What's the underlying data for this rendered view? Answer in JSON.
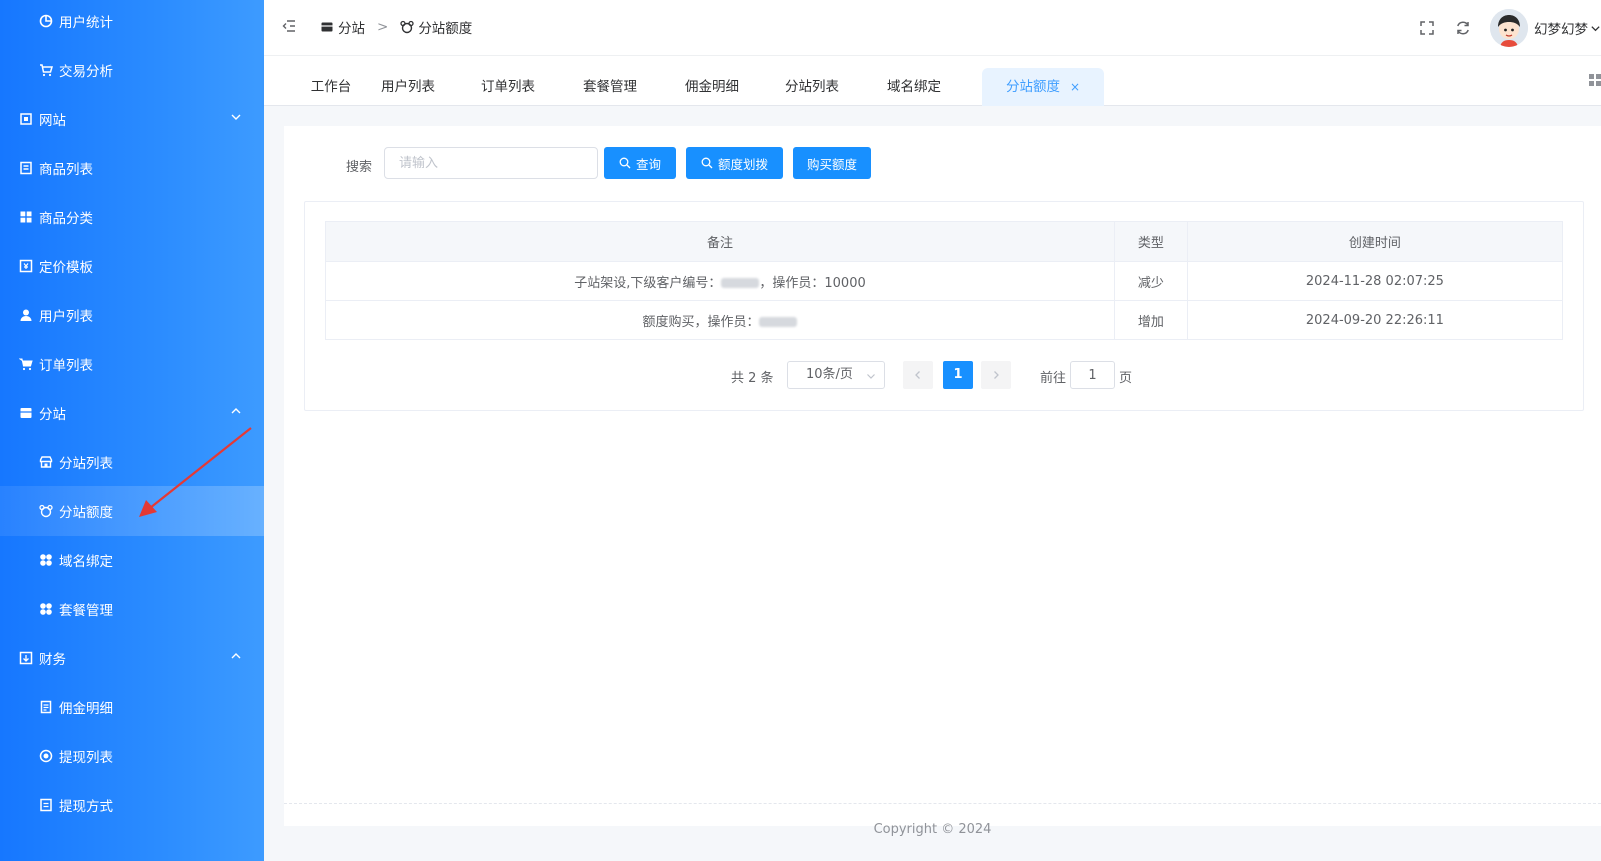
{
  "sidebar": {
    "items": [
      {
        "label": "用户统计",
        "icon": "pie-chart-icon",
        "level": 2
      },
      {
        "label": "交易分析",
        "icon": "cart-icon",
        "level": 2
      },
      {
        "label": "网站",
        "icon": "building-icon",
        "level": 1,
        "expanded": false
      },
      {
        "label": "商品列表",
        "icon": "list-icon",
        "level": 1
      },
      {
        "label": "商品分类",
        "icon": "grid-icon",
        "level": 1
      },
      {
        "label": "定价模板",
        "icon": "price-icon",
        "level": 1
      },
      {
        "label": "用户列表",
        "icon": "user-icon",
        "level": 1
      },
      {
        "label": "订单列表",
        "icon": "cart-icon",
        "level": 1
      },
      {
        "label": "分站",
        "icon": "shop-icon",
        "level": 1,
        "expanded": true
      },
      {
        "label": "分站列表",
        "icon": "store-icon",
        "level": 2
      },
      {
        "label": "分站额度",
        "icon": "bear-icon",
        "level": 2,
        "active": true
      },
      {
        "label": "域名绑定",
        "icon": "flower-icon",
        "level": 2
      },
      {
        "label": "套餐管理",
        "icon": "flower-icon",
        "level": 2
      },
      {
        "label": "财务",
        "icon": "wallet-icon",
        "level": 1,
        "expanded": true
      },
      {
        "label": "佣金明细",
        "icon": "document-icon",
        "level": 2
      },
      {
        "label": "提现列表",
        "icon": "coin-icon",
        "level": 2
      },
      {
        "label": "提现方式",
        "icon": "card-icon",
        "level": 2
      }
    ]
  },
  "header": {
    "breadcrumb": [
      "分站",
      "分站额度"
    ],
    "breadcrumb_sep": ">",
    "username": "幻梦幻梦"
  },
  "tabs": [
    {
      "label": "工作台"
    },
    {
      "label": "用户列表"
    },
    {
      "label": "订单列表"
    },
    {
      "label": "套餐管理"
    },
    {
      "label": "佣金明细"
    },
    {
      "label": "分站列表"
    },
    {
      "label": "域名绑定"
    },
    {
      "label": "分站额度",
      "active": true,
      "close": "×"
    }
  ],
  "search": {
    "label": "搜索",
    "placeholder": "请输入",
    "value": "",
    "query_button": "查询",
    "transfer_button": "额度划拨",
    "buy_button": "购买额度"
  },
  "table": {
    "columns": [
      "备注",
      "类型",
      "创建时间"
    ],
    "rows": [
      {
        "remark_prefix": "子站架设,下级客户编号：",
        "remark_suffix": "，操作员：10000",
        "type": "减少",
        "time": "2024-11-28 02:07:25"
      },
      {
        "remark_prefix": "额度购买，操作员：",
        "remark_suffix": "",
        "type": "增加",
        "time": "2024-09-20 22:26:11"
      }
    ]
  },
  "pagination": {
    "total": "共 2 条",
    "page_size": "10条/页",
    "current": "1",
    "goto_label": "前往",
    "goto_value": "1",
    "page_suffix": "页"
  },
  "footer": {
    "text": "Copyright © 2024"
  },
  "colors": {
    "primary": "#1890ff",
    "sidebar": "#1677ff",
    "annotation_arrow": "#e53935"
  }
}
